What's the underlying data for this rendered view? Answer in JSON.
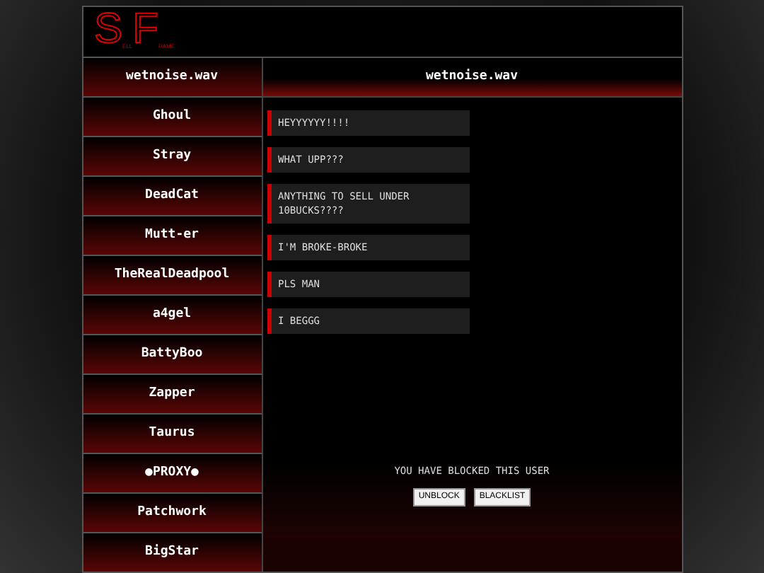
{
  "logo": {
    "letters": [
      {
        "big": "S",
        "small": "ELL"
      },
      {
        "big": "F",
        "small": "RAME"
      }
    ]
  },
  "contacts": [
    "wetnoise.wav",
    "Ghoul",
    "Stray",
    "DeadCat",
    "Mutt-er",
    "TheRealDeadpool",
    "a4gel",
    "BattyBoo",
    "Zapper",
    "Taurus",
    "●PROXY●",
    "Patchwork",
    "BigStar"
  ],
  "chat": {
    "title": "wetnoise.wav",
    "messages": [
      "HEYYYYYY!!!!",
      "WHAT UPP???",
      "ANYTHING TO SELL UNDER 10BUCKS????",
      "I'M BROKE-BROKE",
      "PLS MAN",
      "I BEGGG"
    ],
    "blocked_notice": "YOU HAVE BLOCKED THIS USER",
    "buttons": [
      "UNBLOCK",
      "BLACKLIST"
    ]
  }
}
